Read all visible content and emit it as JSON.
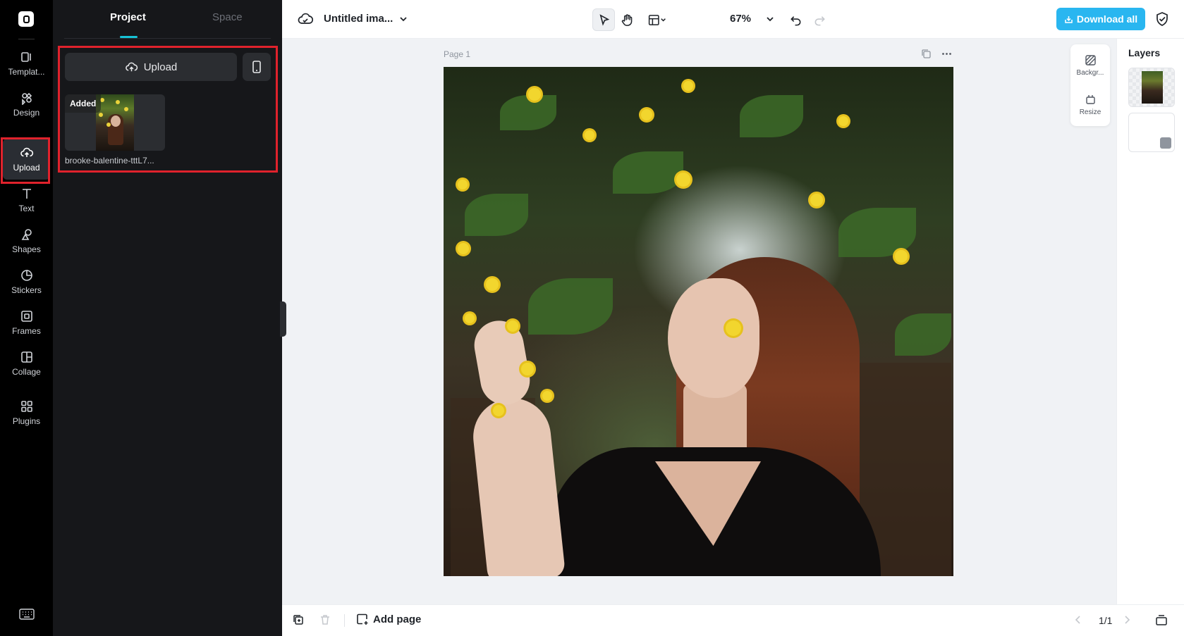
{
  "rail": {
    "items": [
      {
        "label": "Templat..."
      },
      {
        "label": "Design"
      },
      {
        "label": "Upload"
      },
      {
        "label": "Text"
      },
      {
        "label": "Shapes"
      },
      {
        "label": "Stickers"
      },
      {
        "label": "Frames"
      },
      {
        "label": "Collage"
      },
      {
        "label": "Plugins"
      }
    ]
  },
  "panel": {
    "tabs": [
      "Project",
      "Space"
    ],
    "upload_label": "Upload",
    "asset": {
      "badge": "Added",
      "name": "brooke-balentine-tttL7..."
    }
  },
  "topbar": {
    "doc_title": "Untitled ima...",
    "zoom": "67%",
    "download_label": "Download all"
  },
  "canvas": {
    "page_label": "Page 1"
  },
  "side_tools": {
    "background_label": "Backgr...",
    "resize_label": "Resize"
  },
  "layers": {
    "header": "Layers"
  },
  "bottombar": {
    "add_page_label": "Add page",
    "pager": "1/1"
  },
  "colors": {
    "accent": "#16c2d5",
    "download": "#29b6f0",
    "highlight": "#e0222c"
  }
}
